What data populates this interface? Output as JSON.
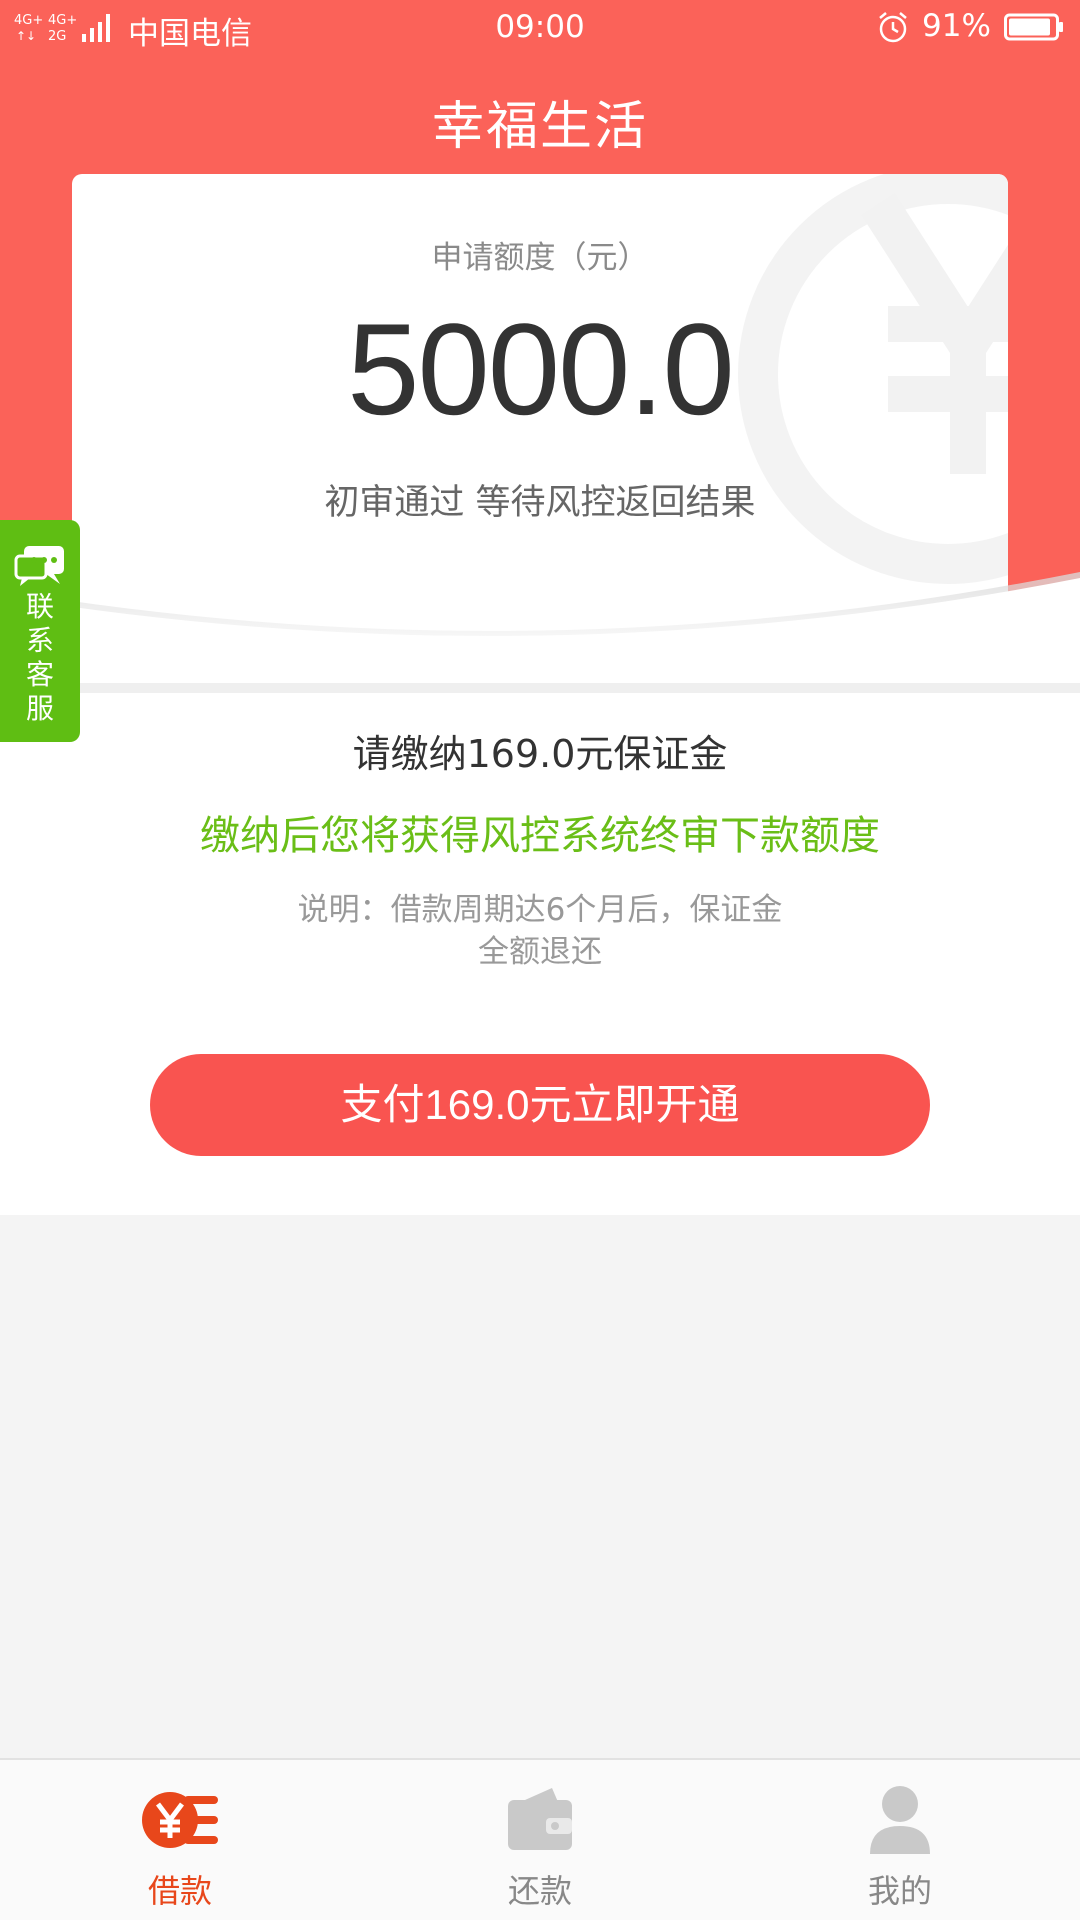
{
  "status_bar": {
    "carrier": "中国电信",
    "time": "09:00",
    "battery": "91%",
    "battery_level": 0.91
  },
  "app_title": "幸福生活",
  "card": {
    "amount_label": "申请额度（元）",
    "amount": "5000.0",
    "status": "初审通过 等待风控返回结果"
  },
  "service": {
    "label_chars": [
      "联",
      "系",
      "客",
      "服"
    ]
  },
  "info": {
    "deposit": "请缴纳169.0元保证金",
    "benefit": "缴纳后您将获得风控系统终审下款额度",
    "note_line1": "说明：借款周期达6个月后，保证金",
    "note_line2": "全额退还",
    "pay_button": "支付169.0元立即开通"
  },
  "nav": {
    "items": [
      {
        "label": "借款",
        "icon": "yen-coin-icon",
        "active": true
      },
      {
        "label": "还款",
        "icon": "wallet-icon",
        "active": false
      },
      {
        "label": "我的",
        "icon": "user-icon",
        "active": false
      }
    ]
  },
  "colors": {
    "brand": "#fb6259",
    "button": "#f95450",
    "green": "#6abe17",
    "active_nav": "#e8471b"
  }
}
